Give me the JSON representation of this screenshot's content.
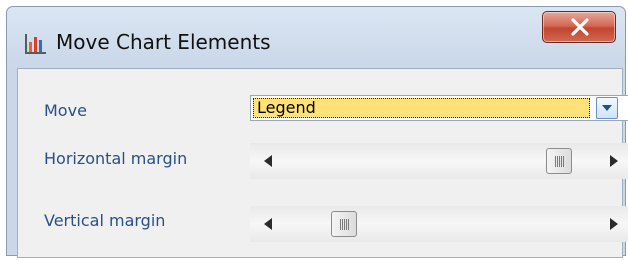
{
  "window": {
    "title": "Move Chart Elements"
  },
  "form": {
    "move": {
      "label": "Move",
      "selected": "Legend"
    },
    "horizontal_margin": {
      "label": "Horizontal margin",
      "value_fraction": 0.91
    },
    "vertical_margin": {
      "label": "Vertical margin",
      "value_fraction": 0.17
    }
  },
  "icons": {
    "app": "chart-icon",
    "close": "close-icon",
    "dropdown": "chevron-down-icon",
    "scroll_left": "arrow-left-icon",
    "scroll_right": "arrow-right-icon"
  },
  "colors": {
    "selection_highlight": "#ffe27a",
    "close_button": "#c24530",
    "label_text": "#2a4f88",
    "title_bar": "#dbe6f3"
  }
}
